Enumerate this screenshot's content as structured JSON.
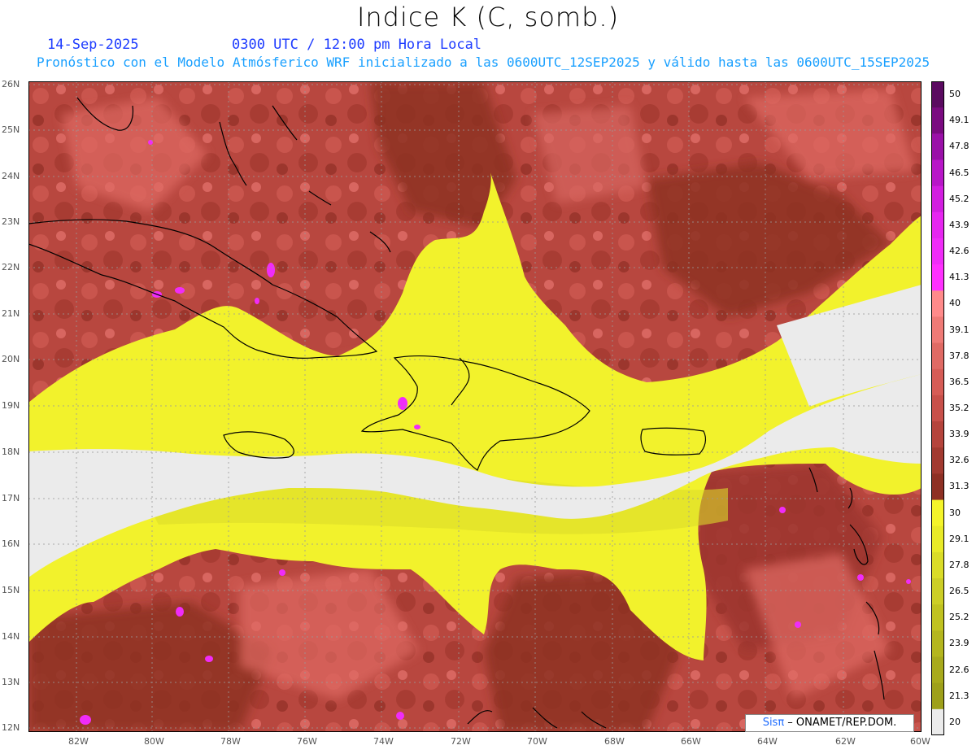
{
  "header": {
    "title": "Indice K (C, somb.)",
    "date": "14-Sep-2025",
    "time": "0300 UTC / 12:00 pm Hora Local",
    "subtitle": "Pronóstico con el Modelo Atmósferico WRF inicializado a las 0600UTC_12SEP2025 y válido hasta las  0600UTC_15SEP2025"
  },
  "axes": {
    "lat_labels": [
      "26N",
      "25N",
      "24N",
      "23N",
      "22N",
      "21N",
      "20N",
      "19N",
      "18N",
      "17N",
      "16N",
      "15N",
      "14N",
      "13N",
      "12N"
    ],
    "lon_labels": [
      "82W",
      "80W",
      "78W",
      "76W",
      "74W",
      "72W",
      "70W",
      "68W",
      "66W",
      "64W",
      "62W",
      "60W"
    ]
  },
  "colorbar": {
    "labels": [
      "50",
      "49.1",
      "47.8",
      "46.5",
      "45.2",
      "43.9",
      "42.6",
      "41.3",
      "40",
      "39.1",
      "37.8",
      "36.5",
      "35.2",
      "33.9",
      "32.6",
      "31.3",
      "30",
      "29.1",
      "27.8",
      "26.5",
      "25.2",
      "23.9",
      "22.6",
      "21.3",
      "20"
    ],
    "colors": [
      "#5a0a60",
      "#7a0a80",
      "#9a10a8",
      "#b816c8",
      "#d21ee0",
      "#e626f0",
      "#f02cf8",
      "#ff30ff",
      "#ff8a8a",
      "#ef7a76",
      "#e06a64",
      "#d65c56",
      "#c8504a",
      "#b5443c",
      "#a23a30",
      "#8e3024",
      "#f4f42a",
      "#e8ea28",
      "#dadc28",
      "#ccce26",
      "#c0c220",
      "#b4b61e",
      "#a8aa1c",
      "#9ea01a",
      "#ebebeb"
    ]
  },
  "legend_colors": {
    "background_low": "#ebebeb",
    "yellow": "#f2f22c",
    "red_dark": "#8e3024",
    "red_mid": "#b8473f",
    "red_light": "#e06a64",
    "magenta": "#f02cf8"
  },
  "credit": {
    "sis": "Sisπ",
    "rest": " – ONAMET/REP.DOM."
  }
}
